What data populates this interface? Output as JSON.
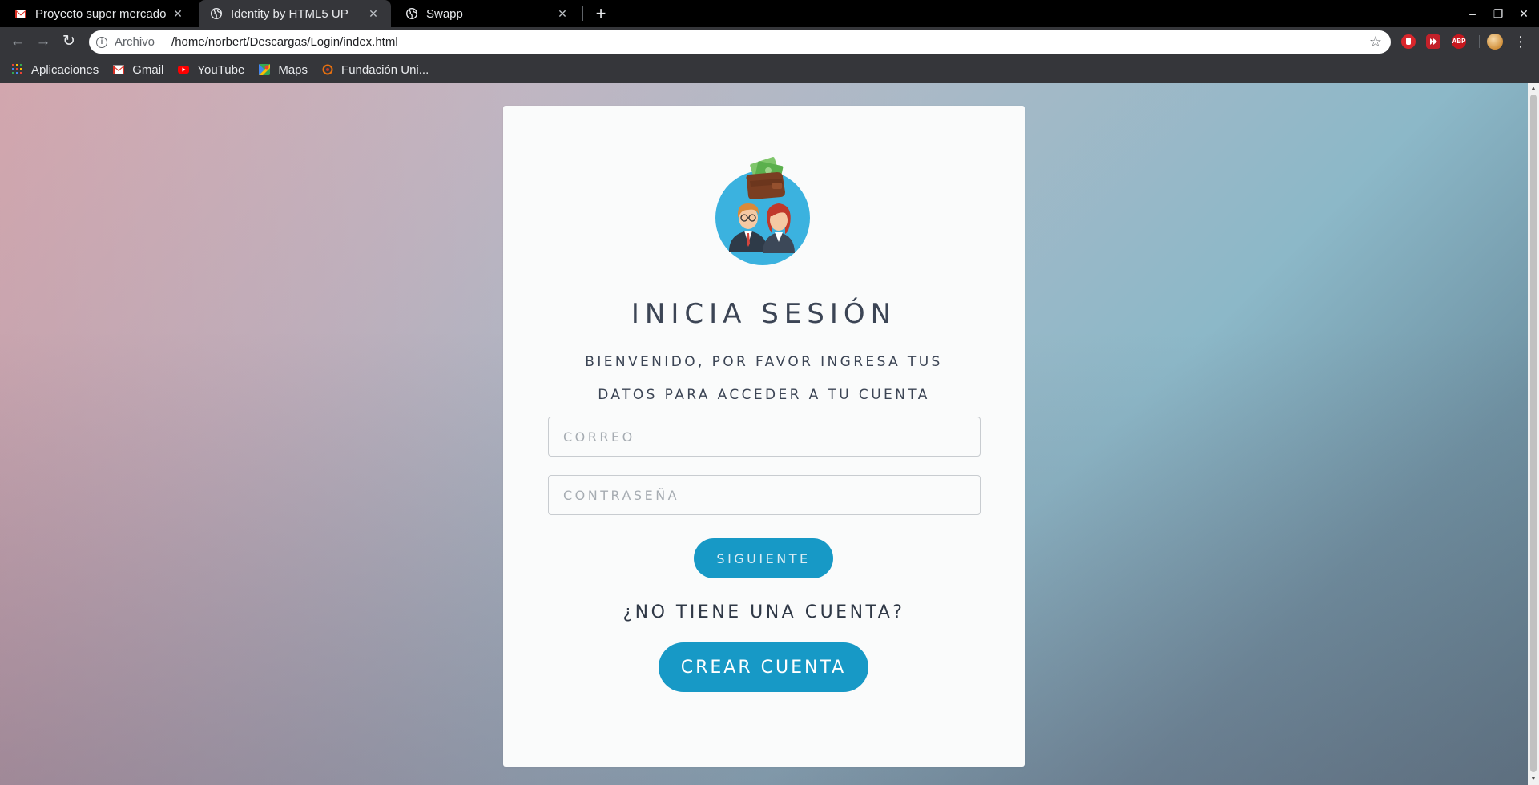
{
  "browser": {
    "tabs": [
      {
        "title": "Proyecto super mercado -",
        "icon": "gmail-icon",
        "active": false
      },
      {
        "title": "Identity by HTML5 UP",
        "icon": "globe-icon",
        "active": true
      },
      {
        "title": "Swapp",
        "icon": "globe-icon",
        "active": false
      }
    ],
    "new_tab_label": "+",
    "window_controls": {
      "minimize": "–",
      "restore": "❐",
      "close": "✕"
    },
    "nav": {
      "back": "←",
      "forward": "→",
      "reload": "↻"
    },
    "address": {
      "scheme_label": "Archivo",
      "url": "/home/norbert/Descargas/Login/index.html"
    },
    "bookmark_star": "☆",
    "extensions": [
      {
        "name": "stop-extension-icon",
        "label": "",
        "color": "#d9262c"
      },
      {
        "name": "media-extension-icon",
        "label": "",
        "color": "#c3212a"
      },
      {
        "name": "adblock-extension-icon",
        "label": "ABP",
        "color": "#c7171e"
      }
    ],
    "menu_label": "⋮",
    "bookmarks": [
      {
        "label": "Aplicaciones",
        "icon": "apps-grid-icon"
      },
      {
        "label": "Gmail",
        "icon": "gmail-icon"
      },
      {
        "label": "YouTube",
        "icon": "youtube-icon"
      },
      {
        "label": "Maps",
        "icon": "maps-icon"
      },
      {
        "label": "Fundación Uni...",
        "icon": "fundacion-icon"
      }
    ]
  },
  "login": {
    "title": "INICIA SESIÓN",
    "subtitle": "BIENVENIDO, POR FAVOR INGRESA TUS DATOS PARA ACCEDER A TU CUENTA",
    "email_placeholder": "CORREO",
    "email_value": "",
    "password_placeholder": "CONTRASEÑA",
    "password_value": "",
    "next_button": "SIGUIENTE",
    "no_account_text": "¿NO TIENE UNA CUENTA?",
    "create_button": "CREAR CUENTA",
    "logo_icon": "users-wallet-logo-icon"
  },
  "colors": {
    "accent": "#1799c6",
    "card": "#fafbfb",
    "text": "#3c4555"
  }
}
